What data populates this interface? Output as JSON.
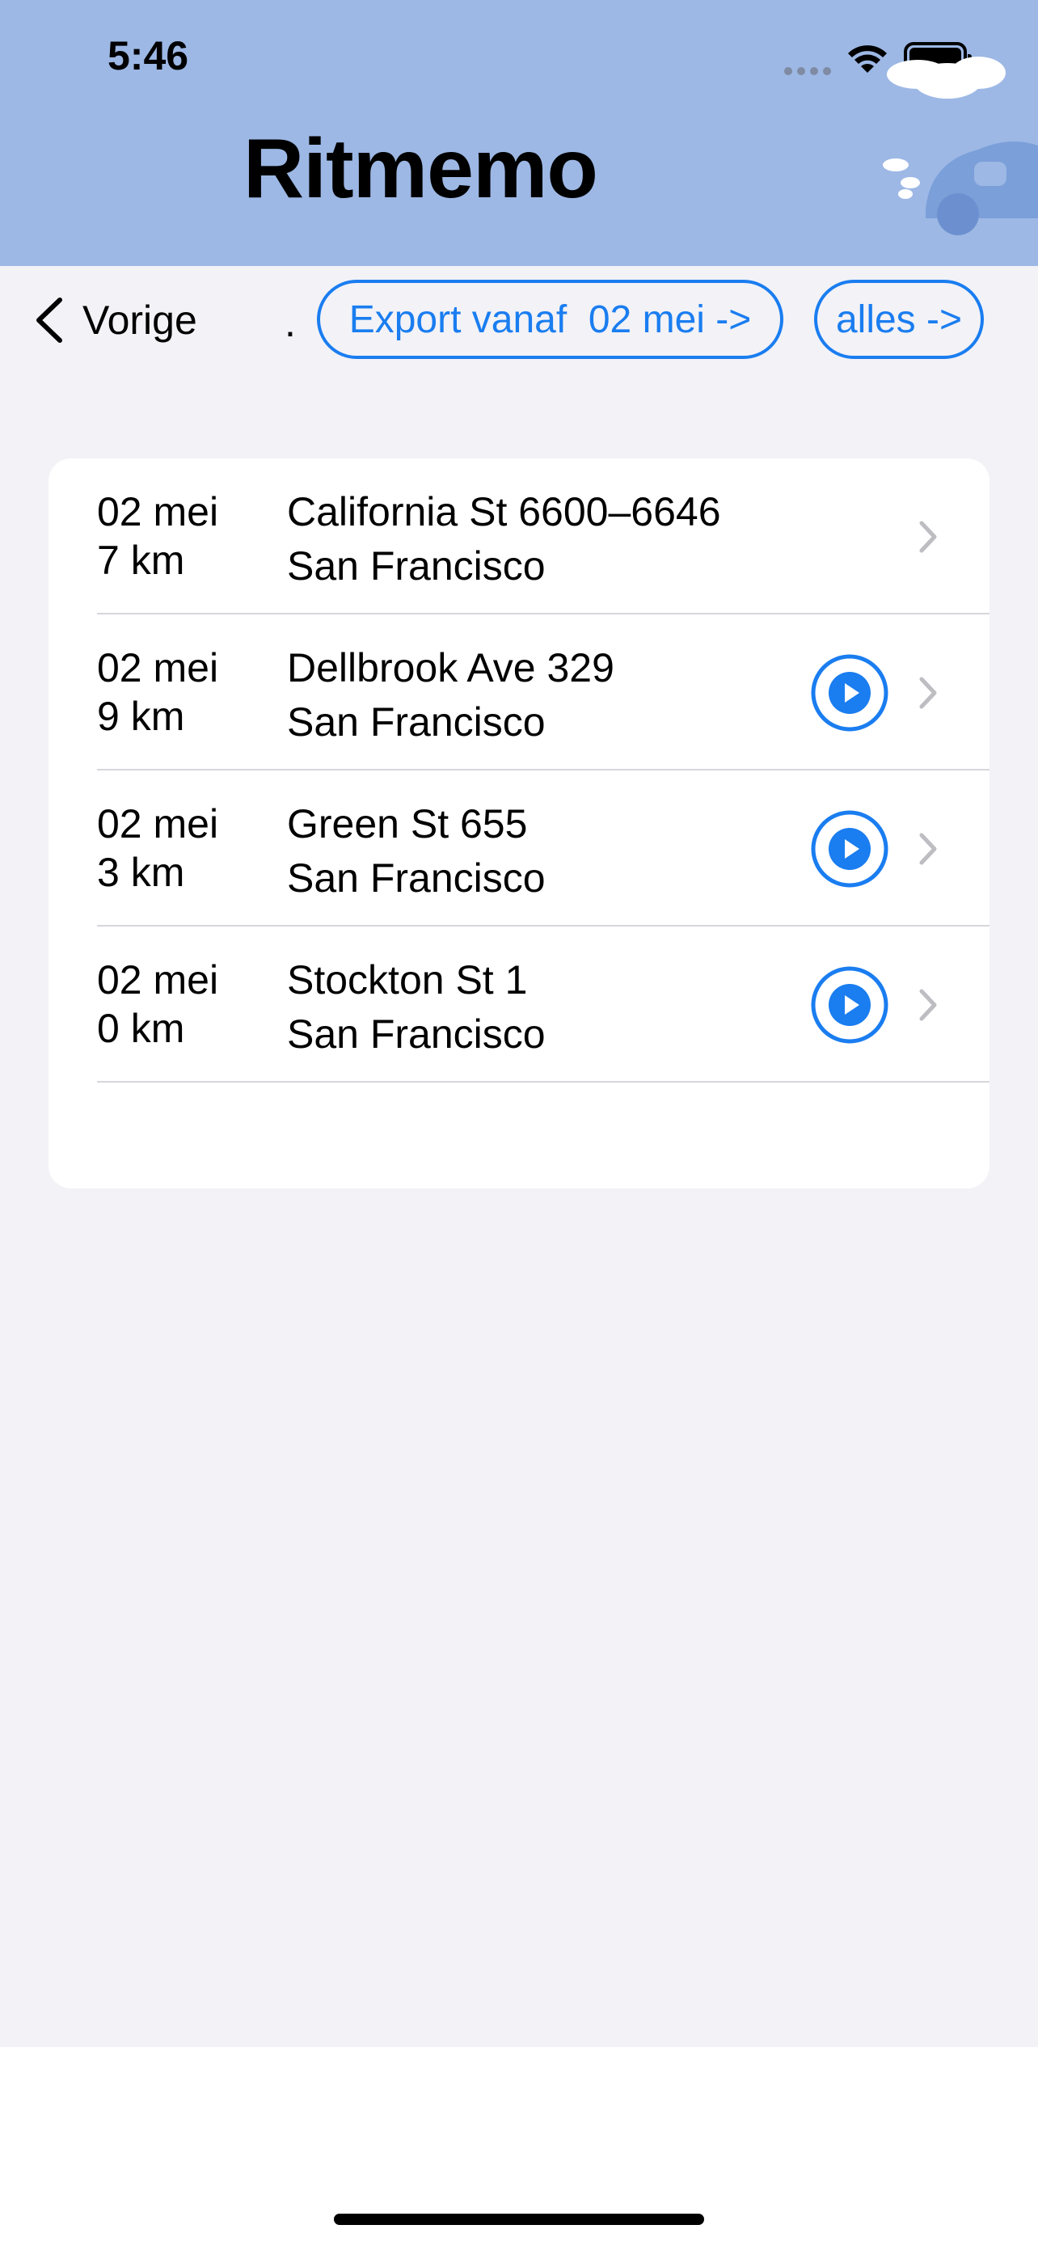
{
  "status_bar": {
    "time": "5:46"
  },
  "header": {
    "title": "Ritmemo"
  },
  "nav": {
    "back_label": "Vorige",
    "separator": ".",
    "export_button": "Export vanaf  02 mei ->",
    "all_button": "alles ->"
  },
  "trips": [
    {
      "date": "02 mei",
      "distance": "7 km",
      "street": "California St 6600–6646",
      "city": "San Francisco",
      "has_play": false
    },
    {
      "date": "02 mei",
      "distance": "9 km",
      "street": "Dellbrook Ave 329",
      "city": "San Francisco",
      "has_play": true
    },
    {
      "date": "02 mei",
      "distance": "3 km",
      "street": "Green St 655",
      "city": "San Francisco",
      "has_play": true
    },
    {
      "date": "02 mei",
      "distance": "0 km",
      "street": "Stockton St 1",
      "city": "San Francisco",
      "has_play": true
    }
  ],
  "colors": {
    "header_bg": "#9db8e5",
    "accent": "#1a7df0",
    "page_bg": "#f2f2f7"
  }
}
